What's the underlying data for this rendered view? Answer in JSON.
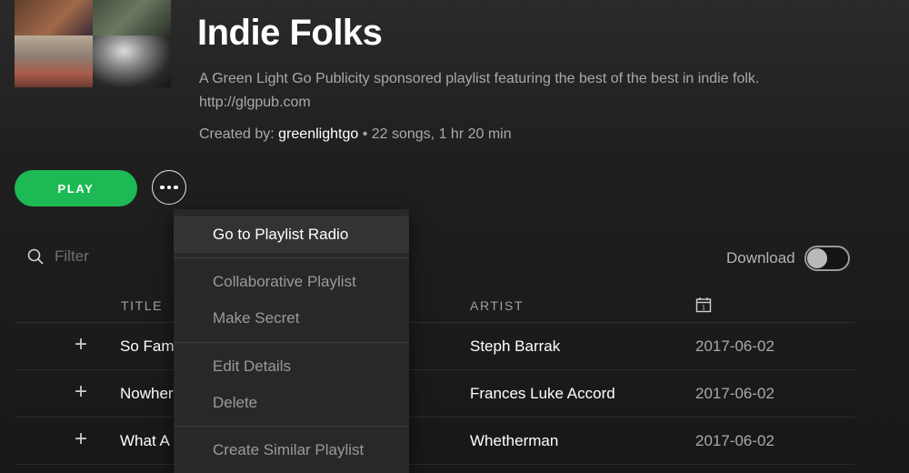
{
  "playlist": {
    "title": "Indie Folks",
    "description": "A Green Light Go Publicity sponsored playlist featuring the best of the best in indie folk. http://glgpub.com",
    "created_by_label": "Created by:",
    "owner": "greenlightgo",
    "stats": " • 22 songs, 1 hr 20 min"
  },
  "actions": {
    "play_label": "PLAY",
    "more_icon": "more-icon"
  },
  "filter": {
    "placeholder": "Filter"
  },
  "download": {
    "label": "Download",
    "enabled": false
  },
  "columns": {
    "title": "TITLE",
    "artist": "ARTIST",
    "date_icon": "calendar-icon"
  },
  "tracks": [
    {
      "title": "So Family",
      "artist": "Steph Barrak",
      "date": "2017-06-02"
    },
    {
      "title": "Nowhere",
      "artist": "Frances Luke Accord",
      "date": "2017-06-02"
    },
    {
      "title": "What A",
      "artist": "Whetherman",
      "date": "2017-06-02"
    }
  ],
  "context_menu": {
    "items": [
      {
        "label": "Go to Playlist Radio",
        "active": true
      },
      {
        "label": "Collaborative Playlist"
      },
      {
        "label": "Make Secret"
      },
      {
        "label": "Edit Details"
      },
      {
        "label": "Delete"
      },
      {
        "label": "Create Similar Playlist"
      }
    ]
  }
}
